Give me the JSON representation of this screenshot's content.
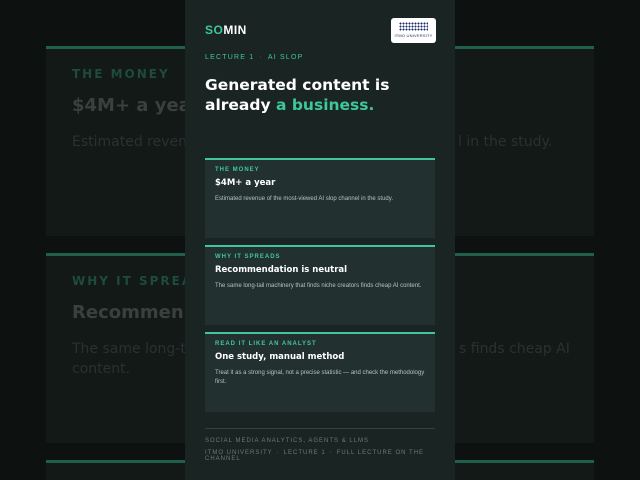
{
  "brand": {
    "logo_part1": "SO",
    "logo_part2": "MIN",
    "university_badge": "ITMO UNIVERSITY"
  },
  "breadcrumb": {
    "lecture": "LECTURE 1",
    "separator": "·",
    "topic": "AI SLOP"
  },
  "headline": {
    "line1": "Generated content is",
    "line2_prefix": "already ",
    "line2_accent": "a business."
  },
  "cards": [
    {
      "eyebrow": "THE MONEY",
      "title": "$4M+ a year",
      "text": "Estimated revenue of the most-viewed AI slop channel in the study."
    },
    {
      "eyebrow": "WHY IT SPREADS",
      "title": "Recommendation is neutral",
      "text": "The same long-tail machinery that finds niche creators finds cheap AI content."
    },
    {
      "eyebrow": "READ IT LIKE AN ANALYST",
      "title": "One study, manual method",
      "text": "Treat it as a strong signal, not a precise statistic — and check the methodology first."
    }
  ],
  "footer": {
    "line1": "SOCIAL MEDIA ANALYTICS, AGENTS & LLMS",
    "university": "ITMO UNIVERSITY",
    "separator": "·",
    "lecture": "LECTURE 1",
    "cta": "FULL LECTURE ON THE CHANNEL"
  },
  "background_blur": {
    "card1": {
      "eyebrow": "THE MONEY",
      "title": "$4M+ a year",
      "text_left": "Estimated reven",
      "text_right": "l in the study."
    },
    "card2": {
      "eyebrow": "WHY IT SPREA",
      "title": "Recommen",
      "text_left": "The same long-t",
      "text_right": "s finds cheap AI",
      "text_left2": "content."
    }
  },
  "colors": {
    "accent": "#3ec79b",
    "panel": "#1a2422",
    "card": "#233030",
    "background": "#0d1211"
  }
}
